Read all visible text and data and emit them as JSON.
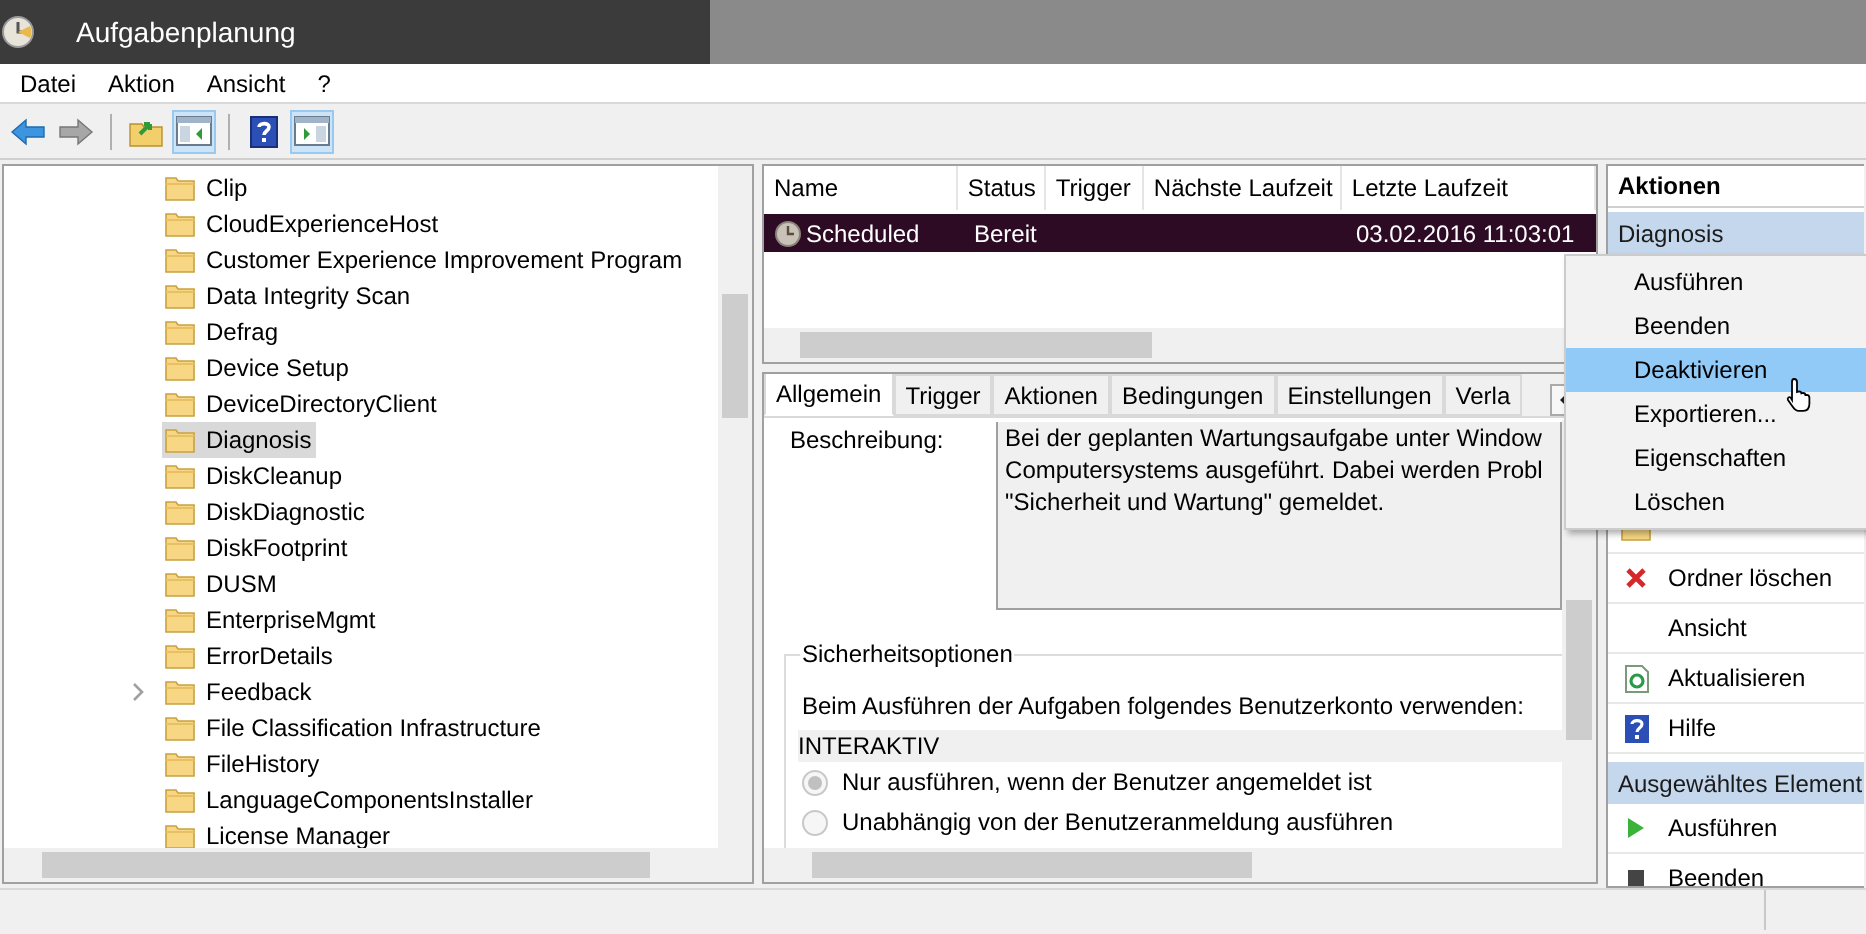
{
  "window": {
    "title": "Aufgabenplanung"
  },
  "menu": [
    "Datei",
    "Aktion",
    "Ansicht",
    "?"
  ],
  "toolbar": [
    {
      "kind": "back",
      "on": false
    },
    {
      "kind": "forward",
      "on": false
    },
    {
      "kind": "up",
      "on": false
    },
    {
      "kind": "tree_pane",
      "on": true
    },
    {
      "kind": "help",
      "on": false
    },
    {
      "kind": "action_pane",
      "on": true
    }
  ],
  "tree": {
    "items": [
      {
        "label": "Clip",
        "selected": false,
        "expandable": false
      },
      {
        "label": "CloudExperienceHost",
        "selected": false,
        "expandable": false
      },
      {
        "label": "Customer Experience Improvement Program",
        "selected": false,
        "expandable": false
      },
      {
        "label": "Data Integrity Scan",
        "selected": false,
        "expandable": false
      },
      {
        "label": "Defrag",
        "selected": false,
        "expandable": false
      },
      {
        "label": "Device Setup",
        "selected": false,
        "expandable": false
      },
      {
        "label": "DeviceDirectoryClient",
        "selected": false,
        "expandable": false
      },
      {
        "label": "Diagnosis",
        "selected": true,
        "expandable": false
      },
      {
        "label": "DiskCleanup",
        "selected": false,
        "expandable": false
      },
      {
        "label": "DiskDiagnostic",
        "selected": false,
        "expandable": false
      },
      {
        "label": "DiskFootprint",
        "selected": false,
        "expandable": false
      },
      {
        "label": "DUSM",
        "selected": false,
        "expandable": false
      },
      {
        "label": "EnterpriseMgmt",
        "selected": false,
        "expandable": false
      },
      {
        "label": "ErrorDetails",
        "selected": false,
        "expandable": false
      },
      {
        "label": "Feedback",
        "selected": false,
        "expandable": true
      },
      {
        "label": "File Classification Infrastructure",
        "selected": false,
        "expandable": false
      },
      {
        "label": "FileHistory",
        "selected": false,
        "expandable": false
      },
      {
        "label": "LanguageComponentsInstaller",
        "selected": false,
        "expandable": false
      },
      {
        "label": "License Manager",
        "selected": false,
        "expandable": false
      }
    ]
  },
  "tasks": {
    "columns": [
      "Name",
      "Status",
      "Trigger",
      "Nächste Laufzeit",
      "Letzte Laufzeit"
    ],
    "rows": [
      {
        "name": "Scheduled",
        "status": "Bereit",
        "last_run": "03.02.2016 11:03:01",
        "selected": true
      }
    ]
  },
  "details": {
    "tabs": [
      {
        "label": "Allgemein",
        "selected": true
      },
      {
        "label": "Trigger",
        "selected": false
      },
      {
        "label": "Aktionen",
        "selected": false
      },
      {
        "label": "Bedingungen",
        "selected": false
      },
      {
        "label": "Einstellungen",
        "selected": false
      },
      {
        "label": "Verla",
        "selected": false
      }
    ],
    "description_label": "Beschreibung:",
    "description": [
      "Bei der geplanten Wartungsaufgabe unter Window",
      "Computersystems ausgeführt. Dabei werden Probl",
      "\"Sicherheit und Wartung\" gemeldet."
    ],
    "security": {
      "title": "Sicherheitsoptionen",
      "account_label": "Beim Ausführen der Aufgaben folgendes Benutzerkonto verwenden:",
      "account": "INTERAKTIV",
      "options": [
        {
          "label": "Nur ausführen, wenn der Benutzer angemeldet ist",
          "selected": true
        },
        {
          "label": "Unabhängig von der Benutzeranmeldung ausführen",
          "selected": false
        }
      ]
    }
  },
  "actions": {
    "title": "Aktionen",
    "sections": [
      {
        "title": "Diagnosis",
        "items": [
          {
            "label": "Ordner löschen",
            "kind": "delete"
          },
          {
            "label": "Ansicht",
            "kind": "plain"
          },
          {
            "label": "Aktualisieren",
            "kind": "refresh"
          },
          {
            "label": "Hilfe",
            "kind": "help"
          }
        ]
      },
      {
        "title": "Ausgewähltes Element",
        "items": [
          {
            "label": "Ausführen",
            "kind": "run"
          },
          {
            "label": "Beenden",
            "kind": "stop"
          }
        ]
      }
    ]
  },
  "context_menu": {
    "items": [
      {
        "label": "Ausführen",
        "selected": false
      },
      {
        "label": "Beenden",
        "selected": false
      },
      {
        "label": "Deaktivieren",
        "selected": true
      },
      {
        "label": "Exportieren...",
        "selected": false
      },
      {
        "label": "Eigenschaften",
        "selected": false
      },
      {
        "label": "Löschen",
        "selected": false
      }
    ]
  }
}
